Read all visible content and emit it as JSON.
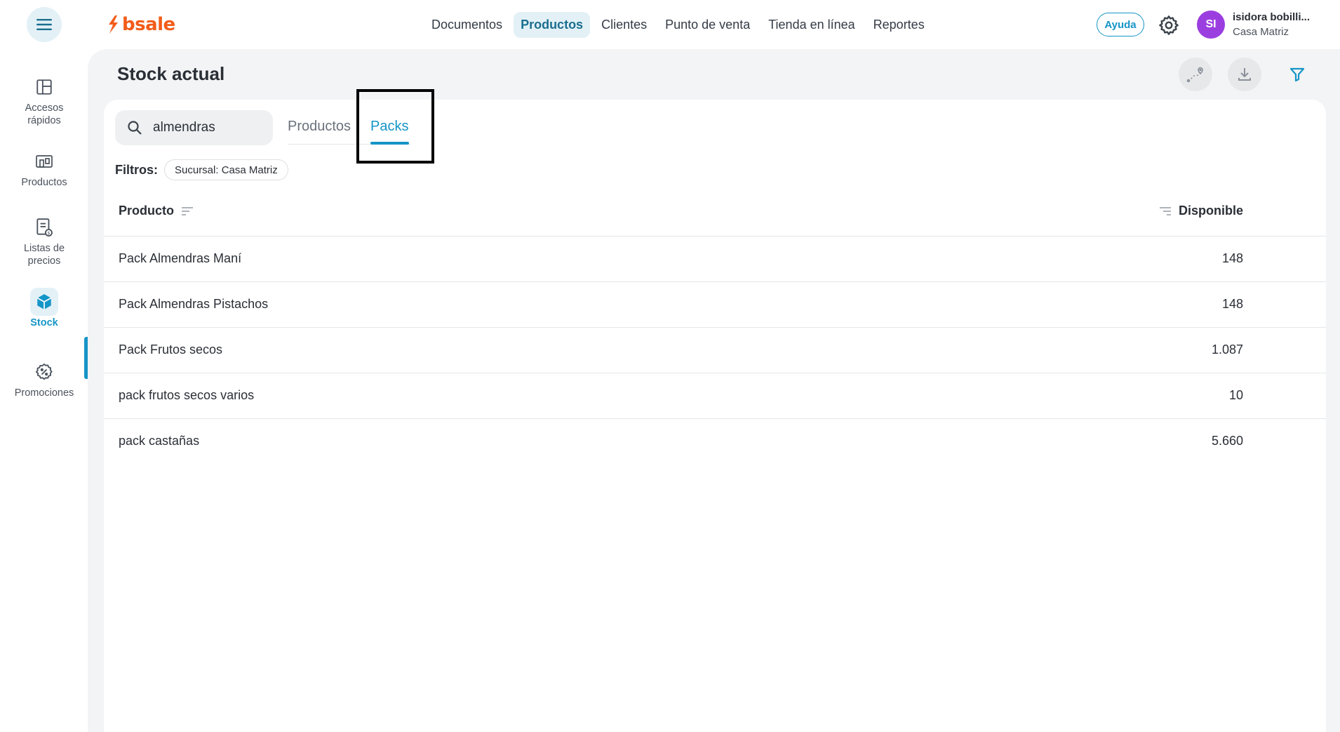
{
  "brand": {
    "name": "bsale",
    "color": "#f25c19"
  },
  "nav": {
    "items": [
      {
        "label": "Documentos",
        "active": false
      },
      {
        "label": "Productos",
        "active": true
      },
      {
        "label": "Clientes",
        "active": false
      },
      {
        "label": "Punto de venta",
        "active": false
      },
      {
        "label": "Tienda en línea",
        "active": false
      },
      {
        "label": "Reportes",
        "active": false
      }
    ]
  },
  "header": {
    "help_label": "Ayuda",
    "user_initials": "SI",
    "user_name": "isidora bobilli...",
    "user_branch": "Casa Matriz"
  },
  "sidebar": {
    "items": [
      {
        "label_line1": "Accesos",
        "label_line2": "rápidos",
        "icon": "layout-icon"
      },
      {
        "label_line1": "Productos",
        "label_line2": "",
        "icon": "products-icon"
      },
      {
        "label_line1": "Listas de",
        "label_line2": "precios",
        "icon": "price-list-icon"
      },
      {
        "label_line1": "Stock",
        "label_line2": "",
        "icon": "box-icon",
        "active": true
      },
      {
        "label_line1": "Promociones",
        "label_line2": "",
        "icon": "discount-icon"
      }
    ]
  },
  "page": {
    "title": "Stock actual",
    "search_value": "almendras",
    "tabs": [
      {
        "label": "Productos",
        "active": false
      },
      {
        "label": "Packs",
        "active": true
      }
    ],
    "filters_label": "Filtros:",
    "filter_chip": "Sucursal: Casa Matriz"
  },
  "table": {
    "columns": {
      "product": "Producto",
      "available": "Disponible"
    },
    "rows": [
      {
        "name": "Pack Almendras Maní",
        "available": "148"
      },
      {
        "name": "Pack Almendras Pistachos",
        "available": "148"
      },
      {
        "name": "Pack Frutos secos",
        "available": "1.087"
      },
      {
        "name": "pack frutos secos varios",
        "available": "10"
      },
      {
        "name": "pack castañas",
        "available": "5.660"
      }
    ]
  },
  "colors": {
    "accent": "#1695c7",
    "accent_bg": "#e3f1f7",
    "avatar": "#9b3ee0"
  }
}
